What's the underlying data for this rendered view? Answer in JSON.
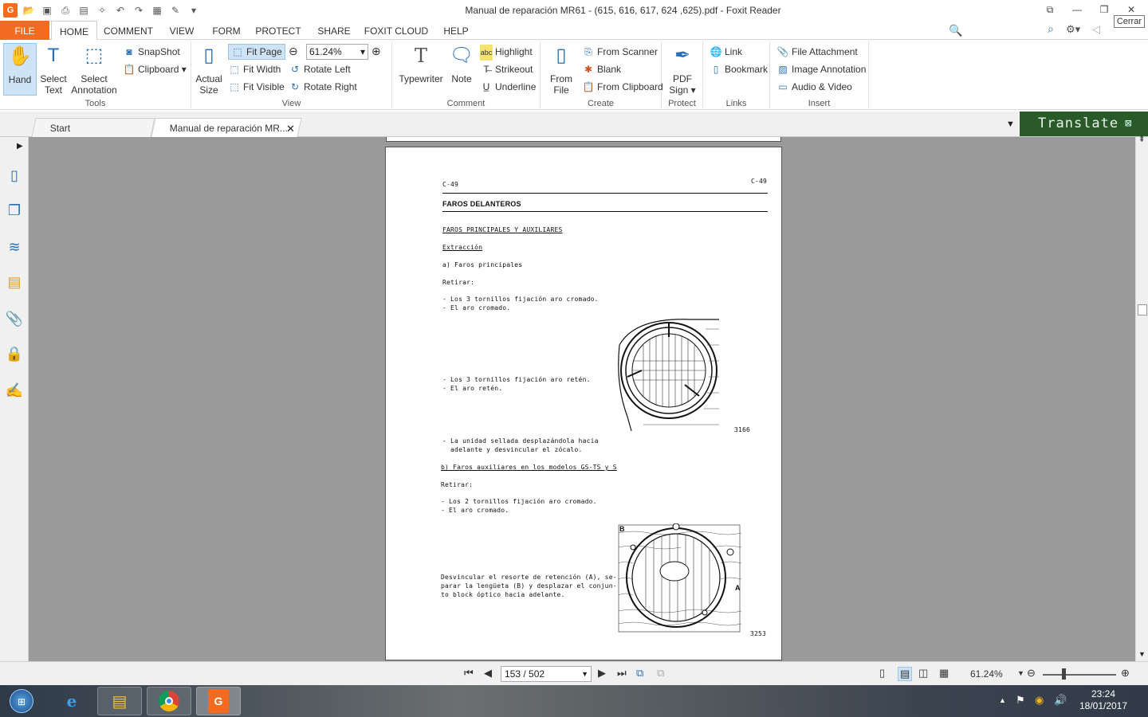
{
  "window": {
    "title": "Manual de reparación MR61 - (615, 616, 617, 624 ,625).pdf - Foxit Reader",
    "tooltip": "Cerrar",
    "buttons": [
      "⧉",
      "—",
      "❐",
      "✕"
    ]
  },
  "qat_icons": [
    "foxit-logo-icon",
    "open-icon",
    "save-icon",
    "print-icon",
    "properties-icon",
    "new-icon",
    "undo-icon",
    "redo-icon",
    "form-icon",
    "pen-icon",
    "more-icon"
  ],
  "menu": {
    "file": "FILE",
    "tabs": [
      "HOME",
      "COMMENT",
      "VIEW",
      "FORM",
      "PROTECT",
      "SHARE",
      "FOXIT CLOUD",
      "HELP"
    ],
    "active": "HOME",
    "find_placeholder": "Find"
  },
  "ribbon": {
    "tools": {
      "label": "Tools",
      "hand": "Hand",
      "select_text_1": "Select",
      "select_text_2": "Text",
      "select_ann_1": "Select",
      "select_ann_2": "Annotation",
      "snapshot": "SnapShot",
      "clipboard": "Clipboard"
    },
    "view": {
      "label": "View",
      "actual_1": "Actual",
      "actual_2": "Size",
      "fit_page": "Fit Page",
      "fit_width": "Fit Width",
      "fit_visible": "Fit Visible",
      "zoom": "61.24%",
      "rotate_left": "Rotate Left",
      "rotate_right": "Rotate Right"
    },
    "comment": {
      "label": "Comment",
      "typewriter": "Typewriter",
      "note": "Note",
      "highlight": "Highlight",
      "strikeout": "Strikeout",
      "underline": "Underline"
    },
    "create": {
      "label": "Create",
      "from_file_1": "From",
      "from_file_2": "File",
      "from_scanner": "From Scanner",
      "blank": "Blank",
      "from_clipboard": "From Clipboard"
    },
    "protect": {
      "label": "Protect",
      "pdf_sign_1": "PDF",
      "pdf_sign_2": "Sign"
    },
    "links": {
      "label": "Links",
      "link": "Link",
      "bookmark": "Bookmark"
    },
    "insert": {
      "label": "Insert",
      "file_attachment": "File Attachment",
      "image_annotation": "Image Annotation",
      "audio_video": "Audio & Video"
    }
  },
  "doc_tabs": [
    {
      "label": "Start"
    },
    {
      "label": "Manual de reparación MR..."
    }
  ],
  "translate_label": "Translate",
  "page": {
    "code_left": "C-49",
    "code_right": "C-49",
    "heading": "FAROS DELANTEROS",
    "subheading": "FAROS PRINCIPALES Y AUXILIARES",
    "extraccion": "Extracción",
    "a_title": "a)  Faros principales",
    "retirar1": "Retirar:",
    "l1": "- Los 3 tornillos fijación aro cromado.",
    "l2": "- El aro cromado.",
    "l3": "- Los 3 tornillos fijación aro retén.",
    "l4": "- El aro retén.",
    "l5": "- La unidad sellada desplazándola hacia",
    "l6": "  adelante y desvincular el zócalo.",
    "b_title": "b)  Faros auxiliares en los modelos GS-TS y S",
    "retirar2": "Retirar:",
    "l7": "- Los 2 tornillos fijación aro cromado.",
    "l8": "- El aro cromado.",
    "l9": "Desvincular el resorte de retención (A), se-",
    "l10": "parar la lengüeta (B) y desplazar el conjun-",
    "l11": "to block óptico hacia adelante.",
    "fig1": "3166",
    "fig2": "3253",
    "fig2_a": "A",
    "fig2_b": "B"
  },
  "status": {
    "page": "153 / 502",
    "zoom": "61.24%"
  },
  "clock": {
    "time": "23:24",
    "date": "18/01/2017"
  }
}
